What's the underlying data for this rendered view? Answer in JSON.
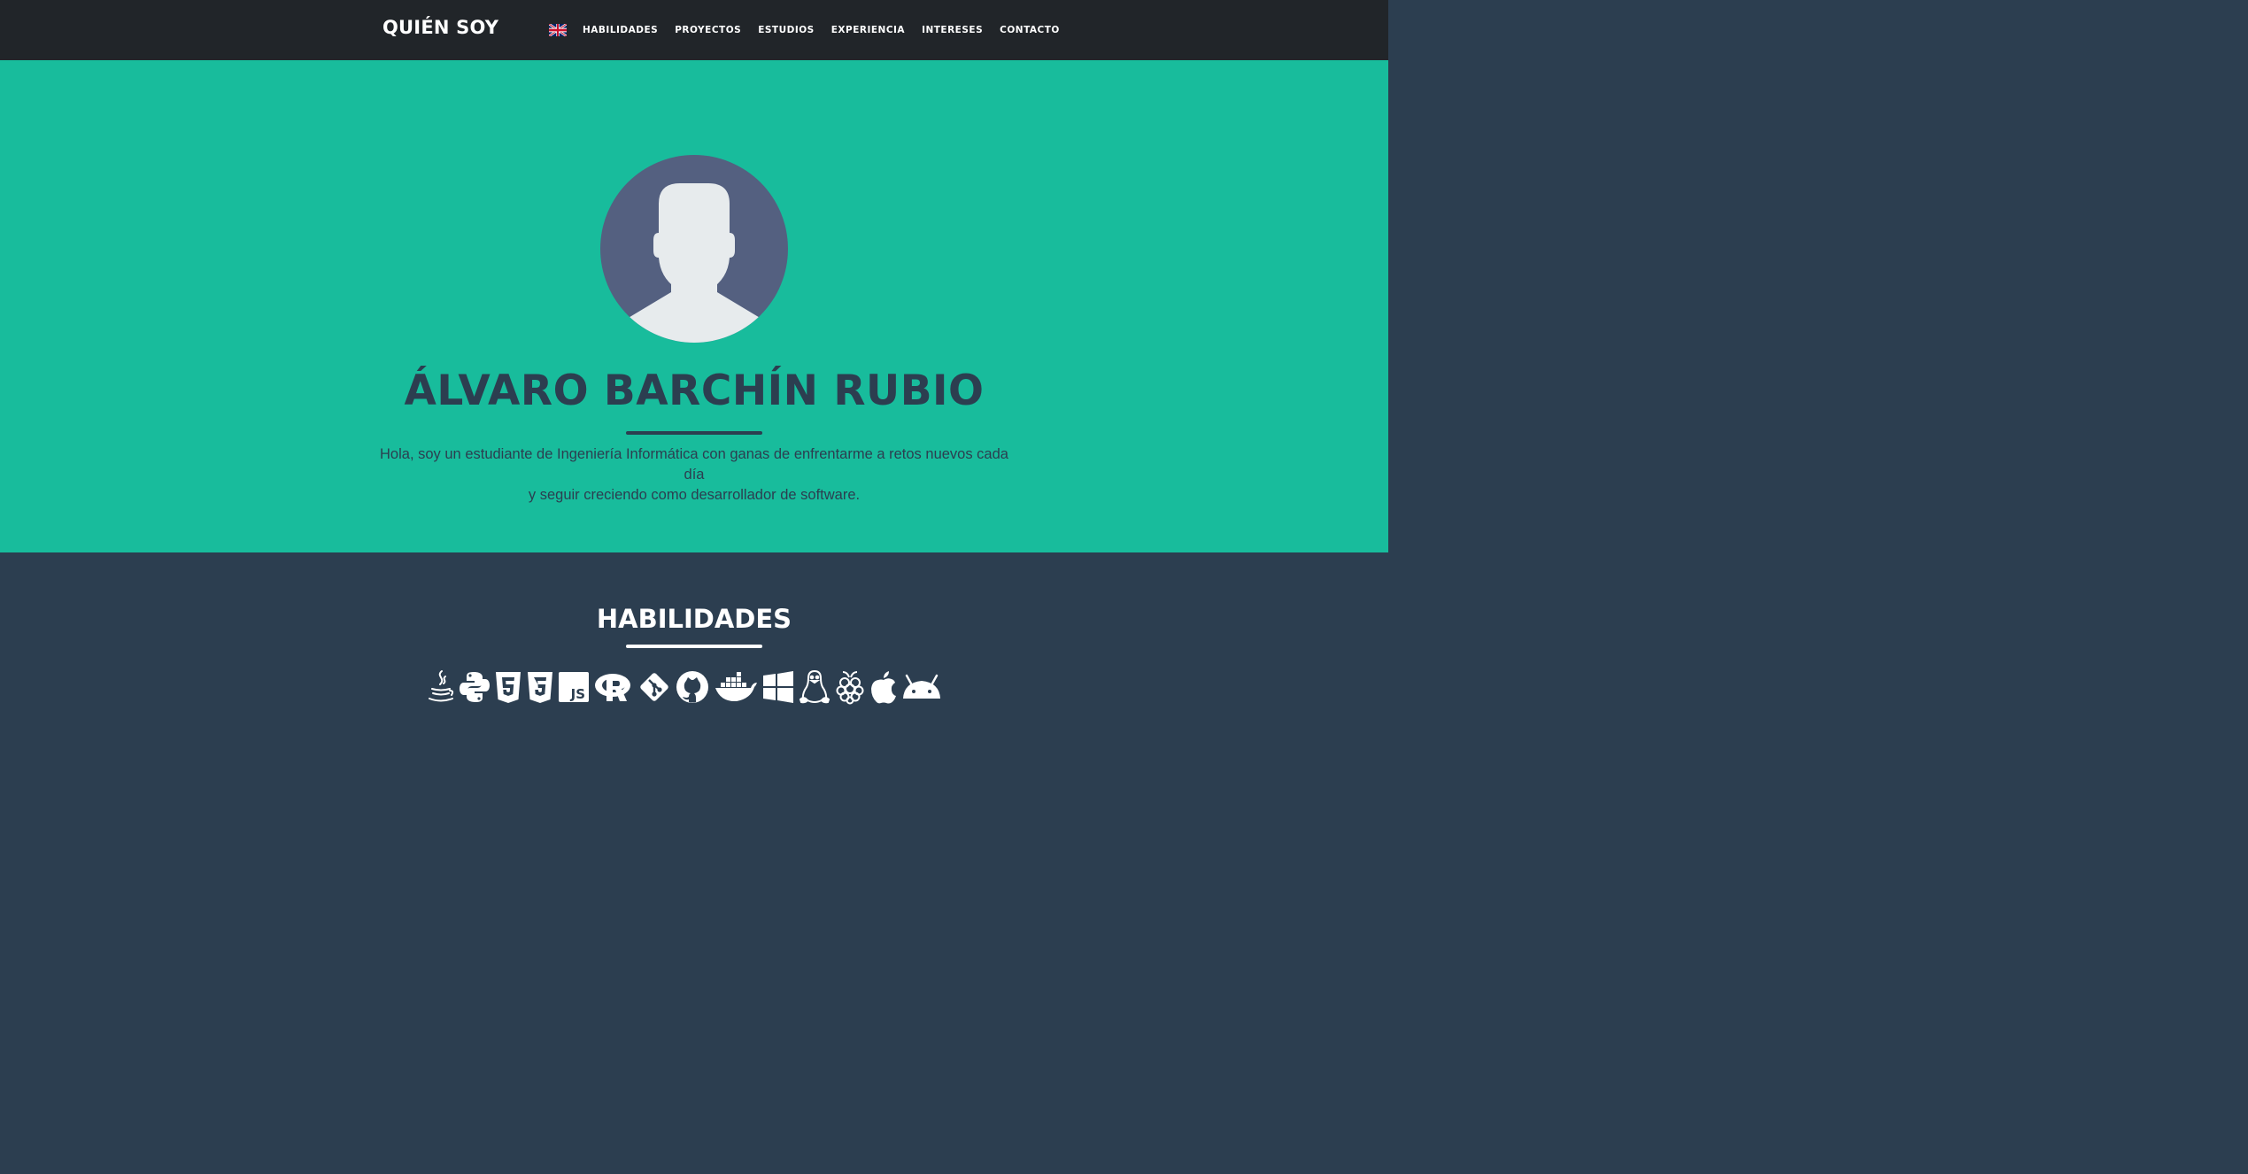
{
  "navbar": {
    "brand": "QUIÉN SOY",
    "language_icon": "uk-flag-icon",
    "links": [
      "HABILIDADES",
      "PROYECTOS",
      "ESTUDIOS",
      "EXPERIENCIA",
      "INTERESES",
      "CONTACTO"
    ]
  },
  "hero": {
    "avatar_icon": "user-avatar-icon",
    "name": "ÁLVARO BARCHÍN RUBIO",
    "intro_line1": "Hola, soy un estudiante de Ingeniería Informática con ganas de enfrentarme a retos nuevos cada día",
    "intro_line2": "y seguir creciendo como desarrollador de software."
  },
  "skills": {
    "title": "HABILIDADES",
    "icons": [
      "java-icon",
      "python-icon",
      "html5-icon",
      "css3-icon",
      "javascript-icon",
      "r-icon",
      "git-icon",
      "github-icon",
      "docker-icon",
      "windows-icon",
      "linux-icon",
      "raspberry-pi-icon",
      "apple-icon",
      "android-icon"
    ]
  },
  "colors": {
    "navbar_bg": "#212529",
    "hero_bg": "#18bc9c",
    "primary_dark": "#2c3e50",
    "avatar_bg": "#546080",
    "avatar_figure": "#e7ebed"
  }
}
